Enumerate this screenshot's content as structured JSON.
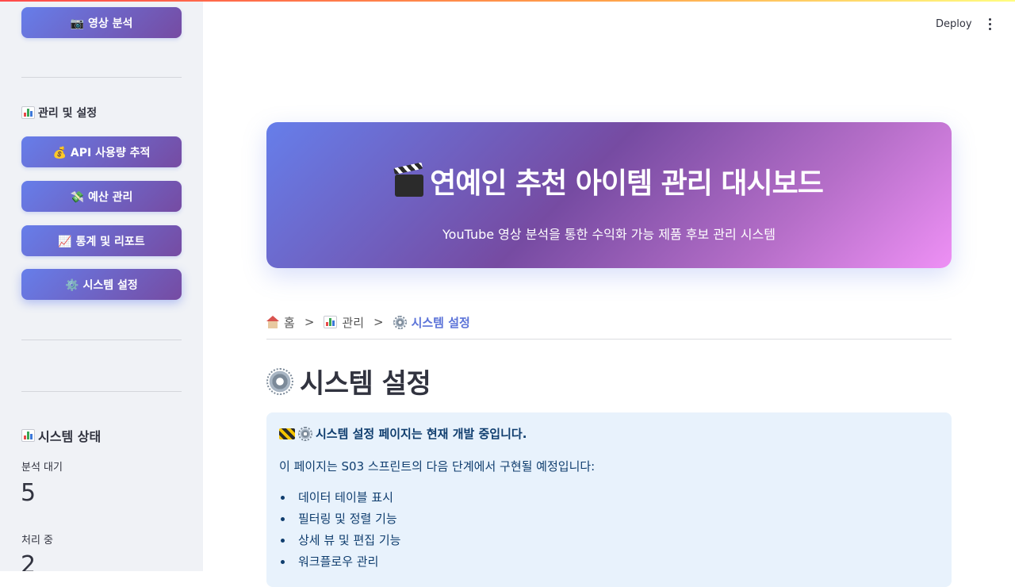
{
  "sidebar": {
    "top_button": {
      "icon": "camera-icon",
      "label": "📷 영상 분석"
    },
    "section_manage": {
      "icon": "bar-chart-icon",
      "label": "관리 및 설정"
    },
    "buttons": [
      {
        "label": "💰 API 사용량 추적"
      },
      {
        "label": "💸 예산 관리"
      },
      {
        "label": "📈 통계 및 리포트"
      },
      {
        "label": "⚙️ 시스템 설정"
      }
    ],
    "status": {
      "icon": "bar-chart-icon",
      "title": "시스템 상태",
      "metrics": [
        {
          "label": "분석 대기",
          "value": "5"
        },
        {
          "label": "처리 중",
          "value": "2"
        }
      ]
    }
  },
  "header": {
    "deploy_label": "Deploy",
    "menu_icon": "kebab-menu-icon"
  },
  "hero": {
    "icon": "clapper-board-icon",
    "title": "연예인 추천 아이템 관리 대시보드",
    "subtitle": "YouTube 영상 분석을 통한 수익화 가능 제품 후보 관리 시스템"
  },
  "breadcrumb": {
    "home": "홈",
    "sep1": ">",
    "manage": "관리",
    "sep2": ">",
    "current": "시스템 설정"
  },
  "page_title": "시스템 설정",
  "info": {
    "headline": "시스템 설정 페이지는 현재 개발 중입니다.",
    "description": "이 페이지는 S03 스프린트의 다음 단계에서 구현될 예정입니다:",
    "items": [
      "데이터 테이블 표시",
      "필터링 및 정렬 기능",
      "상세 뷰 및 편집 기능",
      "워크플로우 관리"
    ]
  },
  "colors": {
    "accent_start": "#667eea",
    "accent_end": "#764ba2",
    "info_bg": "#e8f2fc",
    "info_text": "#0f3d6e"
  }
}
